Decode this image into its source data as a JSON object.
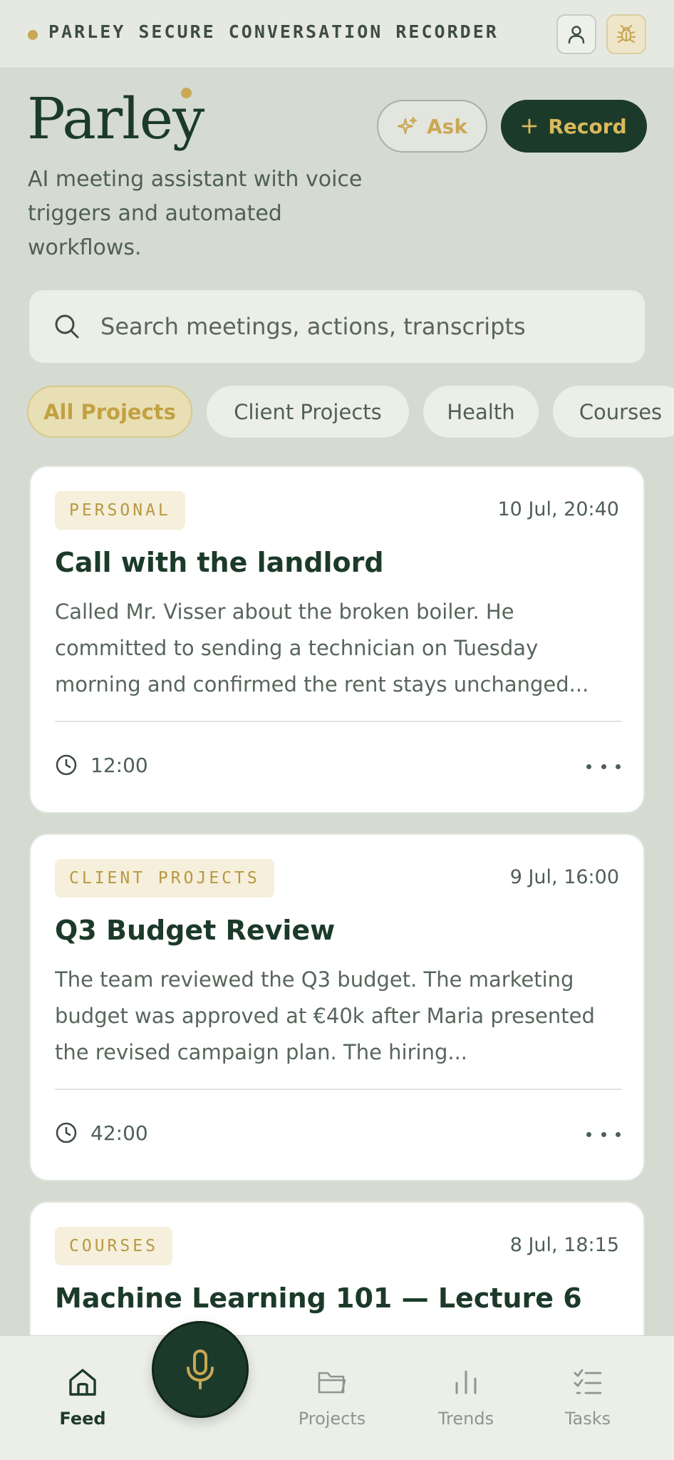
{
  "topbar": {
    "title": "PARLEY SECURE CONVERSATION RECORDER",
    "user_icon": "user-icon",
    "debug_icon": "bug-icon"
  },
  "header": {
    "brand": "Parley",
    "tagline": "AI meeting assistant with voice triggers and automated workflows.",
    "ask_label": "Ask",
    "record_label": "Record"
  },
  "search": {
    "placeholder": "Search meetings, actions, transcripts"
  },
  "filters": [
    "All Projects",
    "Client Projects",
    "Health",
    "Courses"
  ],
  "cards": [
    {
      "tag": "PERSONAL",
      "date": "10 Jul, 20:40",
      "title": "Call with the landlord",
      "summary": "Called Mr. Visser about the broken boiler. He committed to sending a technician on Tuesday morning and confirmed the rent stays unchanged...",
      "duration": "12:00"
    },
    {
      "tag": "CLIENT PROJECTS",
      "date": "9 Jul, 16:00",
      "title": "Q3 Budget Review",
      "summary": "The team reviewed the Q3 budget. The marketing budget was approved at €40k after Maria presented the revised campaign plan. The hiring...",
      "duration": "42:00"
    },
    {
      "tag": "COURSES",
      "date": "8 Jul, 18:15",
      "title": "Machine Learning 101 — Lecture 6",
      "summary": "",
      "duration": ""
    }
  ],
  "nav": [
    {
      "label": "Feed",
      "icon": "home-icon",
      "active": true
    },
    {
      "label": "Projects",
      "icon": "folder-icon",
      "active": false
    },
    {
      "label": "Trends",
      "icon": "bar-chart-icon",
      "active": false
    },
    {
      "label": "Tasks",
      "icon": "checklist-icon",
      "active": false
    }
  ],
  "colors": {
    "primary": "#1c3a2a",
    "accent": "#c9a855",
    "background": "#d5dbd1"
  }
}
